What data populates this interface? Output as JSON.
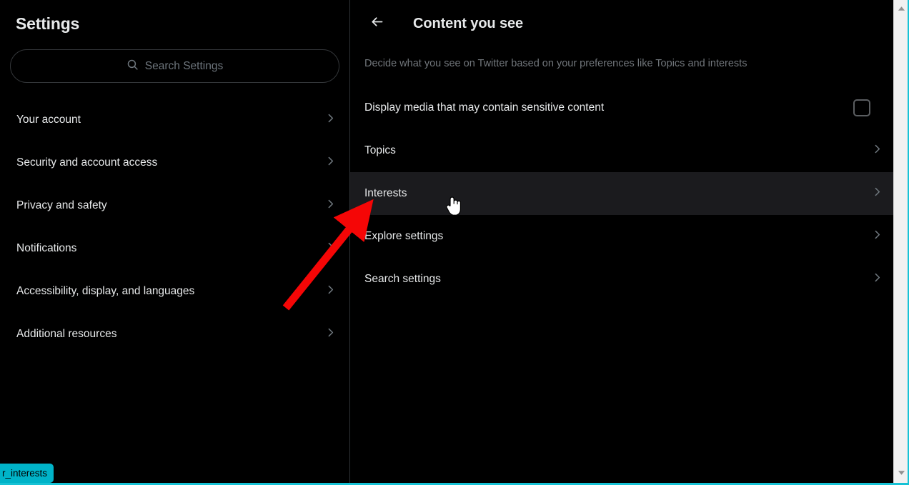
{
  "sidebar": {
    "title": "Settings",
    "search": {
      "placeholder": "Search Settings",
      "icon": "search-icon"
    },
    "items": [
      {
        "label": "Your account",
        "icon": "chevron-right-icon"
      },
      {
        "label": "Security and account access",
        "icon": "chevron-right-icon"
      },
      {
        "label": "Privacy and safety",
        "icon": "chevron-right-icon"
      },
      {
        "label": "Notifications",
        "icon": "chevron-right-icon"
      },
      {
        "label": "Accessibility, display, and languages",
        "icon": "chevron-right-icon"
      },
      {
        "label": "Additional resources",
        "icon": "chevron-right-icon"
      }
    ]
  },
  "detail": {
    "back_icon": "back-arrow-icon",
    "title": "Content you see",
    "description": "Decide what you see on Twitter based on your preferences like Topics and interests",
    "rows": [
      {
        "label": "Display media that may contain sensitive content",
        "control": "checkbox",
        "checked": false,
        "highlighted": false
      },
      {
        "label": "Topics",
        "control": "chevron",
        "highlighted": false
      },
      {
        "label": "Interests",
        "control": "chevron",
        "highlighted": true
      },
      {
        "label": "Explore settings",
        "control": "chevron",
        "highlighted": false
      },
      {
        "label": "Search settings",
        "control": "chevron",
        "highlighted": false
      }
    ]
  },
  "status_tooltip": {
    "text": "r_interests"
  },
  "scrollbar": {
    "up_icon": "scroll-up-arrow-icon",
    "down_icon": "scroll-down-arrow-icon"
  },
  "colors": {
    "background": "#000000",
    "highlight": "#1b1b1e",
    "text_primary": "#e7e9ea",
    "text_secondary": "#71767b",
    "annotation": "#ff0000",
    "tooltip": "#00b3c8",
    "border_cyan": "#16c2d5"
  }
}
